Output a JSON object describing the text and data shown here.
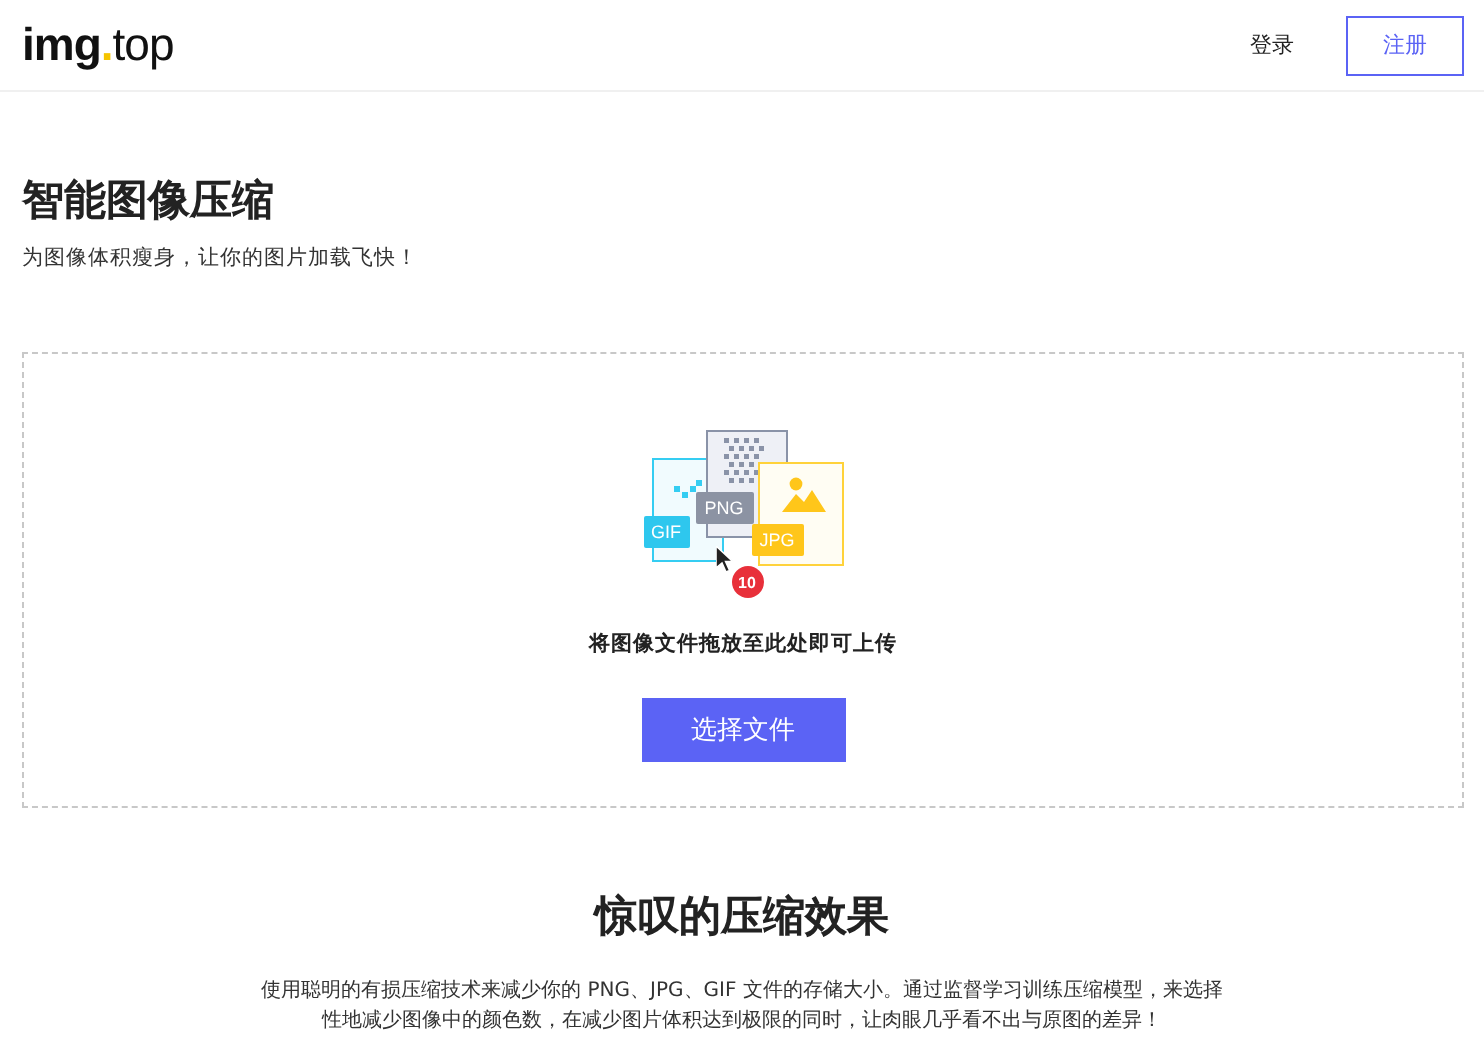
{
  "header": {
    "logo": {
      "main": "img",
      "dot": ".",
      "suffix": "top"
    },
    "links": [
      {
        "label": "登录",
        "kind": "link"
      },
      {
        "label": "注册",
        "kind": "outlined"
      }
    ]
  },
  "hero": {
    "title": "智能图像压缩",
    "subtitle": "为图像体积瘦身，让你的图片加载飞快！"
  },
  "upload": {
    "file_tags": [
      "GIF",
      "PNG",
      "JPG"
    ],
    "count": "10",
    "hint": "将图像文件拖放至此处即可上传",
    "button": "选择文件"
  },
  "feature": {
    "title": "惊叹的压缩效果",
    "text": "使用聪明的有损压缩技术来减少你的 PNG、JPG、GIF 文件的存储大小。通过监督学习训练压缩模型，来选择性地减少图像中的颜色数，在减少图片体积达到极限的同时，让肉眼几乎看不出与原图的差异！"
  }
}
